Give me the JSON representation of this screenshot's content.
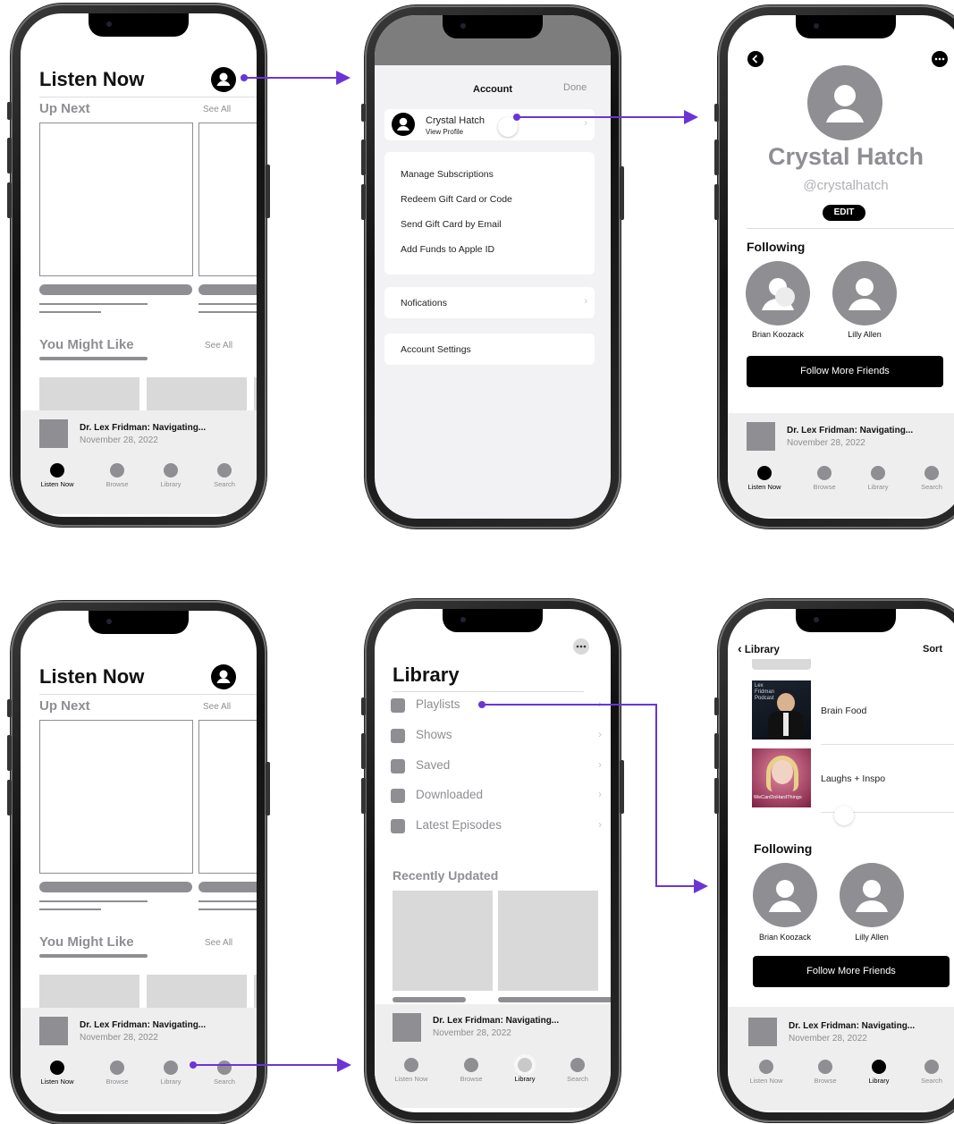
{
  "listen_now": {
    "title": "Listen Now",
    "up_next": "Up Next",
    "see_all": "See All",
    "you_might_like": "You Might Like"
  },
  "mini_player": {
    "title": "Dr. Lex Fridman: Navigating...",
    "date": "November 28, 2022"
  },
  "tabs": {
    "listen_now": "Listen Now",
    "browse": "Browse",
    "library": "Library",
    "search": "Search"
  },
  "account": {
    "title": "Account",
    "done": "Done",
    "profile_name": "Crystal Hatch",
    "profile_sub": "View Profile",
    "items": [
      "Manage Subscriptions",
      "Redeem Gift Card or Code",
      "Send Gift Card by Email",
      "Add Funds to Apple ID"
    ],
    "notifications": "Nofications",
    "settings": "Account Settings"
  },
  "profile": {
    "name": "Crystal Hatch",
    "handle": "@crystalhatch",
    "edit": "EDIT",
    "following": "Following",
    "friends": [
      "Brian Koozack",
      "Lilly Allen"
    ],
    "follow_more": "Follow More Friends"
  },
  "library": {
    "title": "Library",
    "items": [
      "Playlists",
      "Shows",
      "Saved",
      "Downloaded",
      "Latest Episodes"
    ],
    "recently_updated": "Recently Updated"
  },
  "playlists": {
    "back": "Library",
    "sort": "Sort",
    "items": [
      "Brain Food",
      "Laughs + Inspo"
    ],
    "art1_label": "Lex Fridman Podcast",
    "art2_label": "WeCanDoHardThings",
    "following": "Following",
    "friends": [
      "Brian Koozack",
      "Lilly Allen"
    ],
    "follow_more": "Follow More Friends"
  },
  "colors": {
    "accent": "#6b35d6",
    "gray": "#8e8e93",
    "tile": "#d9d9d9"
  }
}
